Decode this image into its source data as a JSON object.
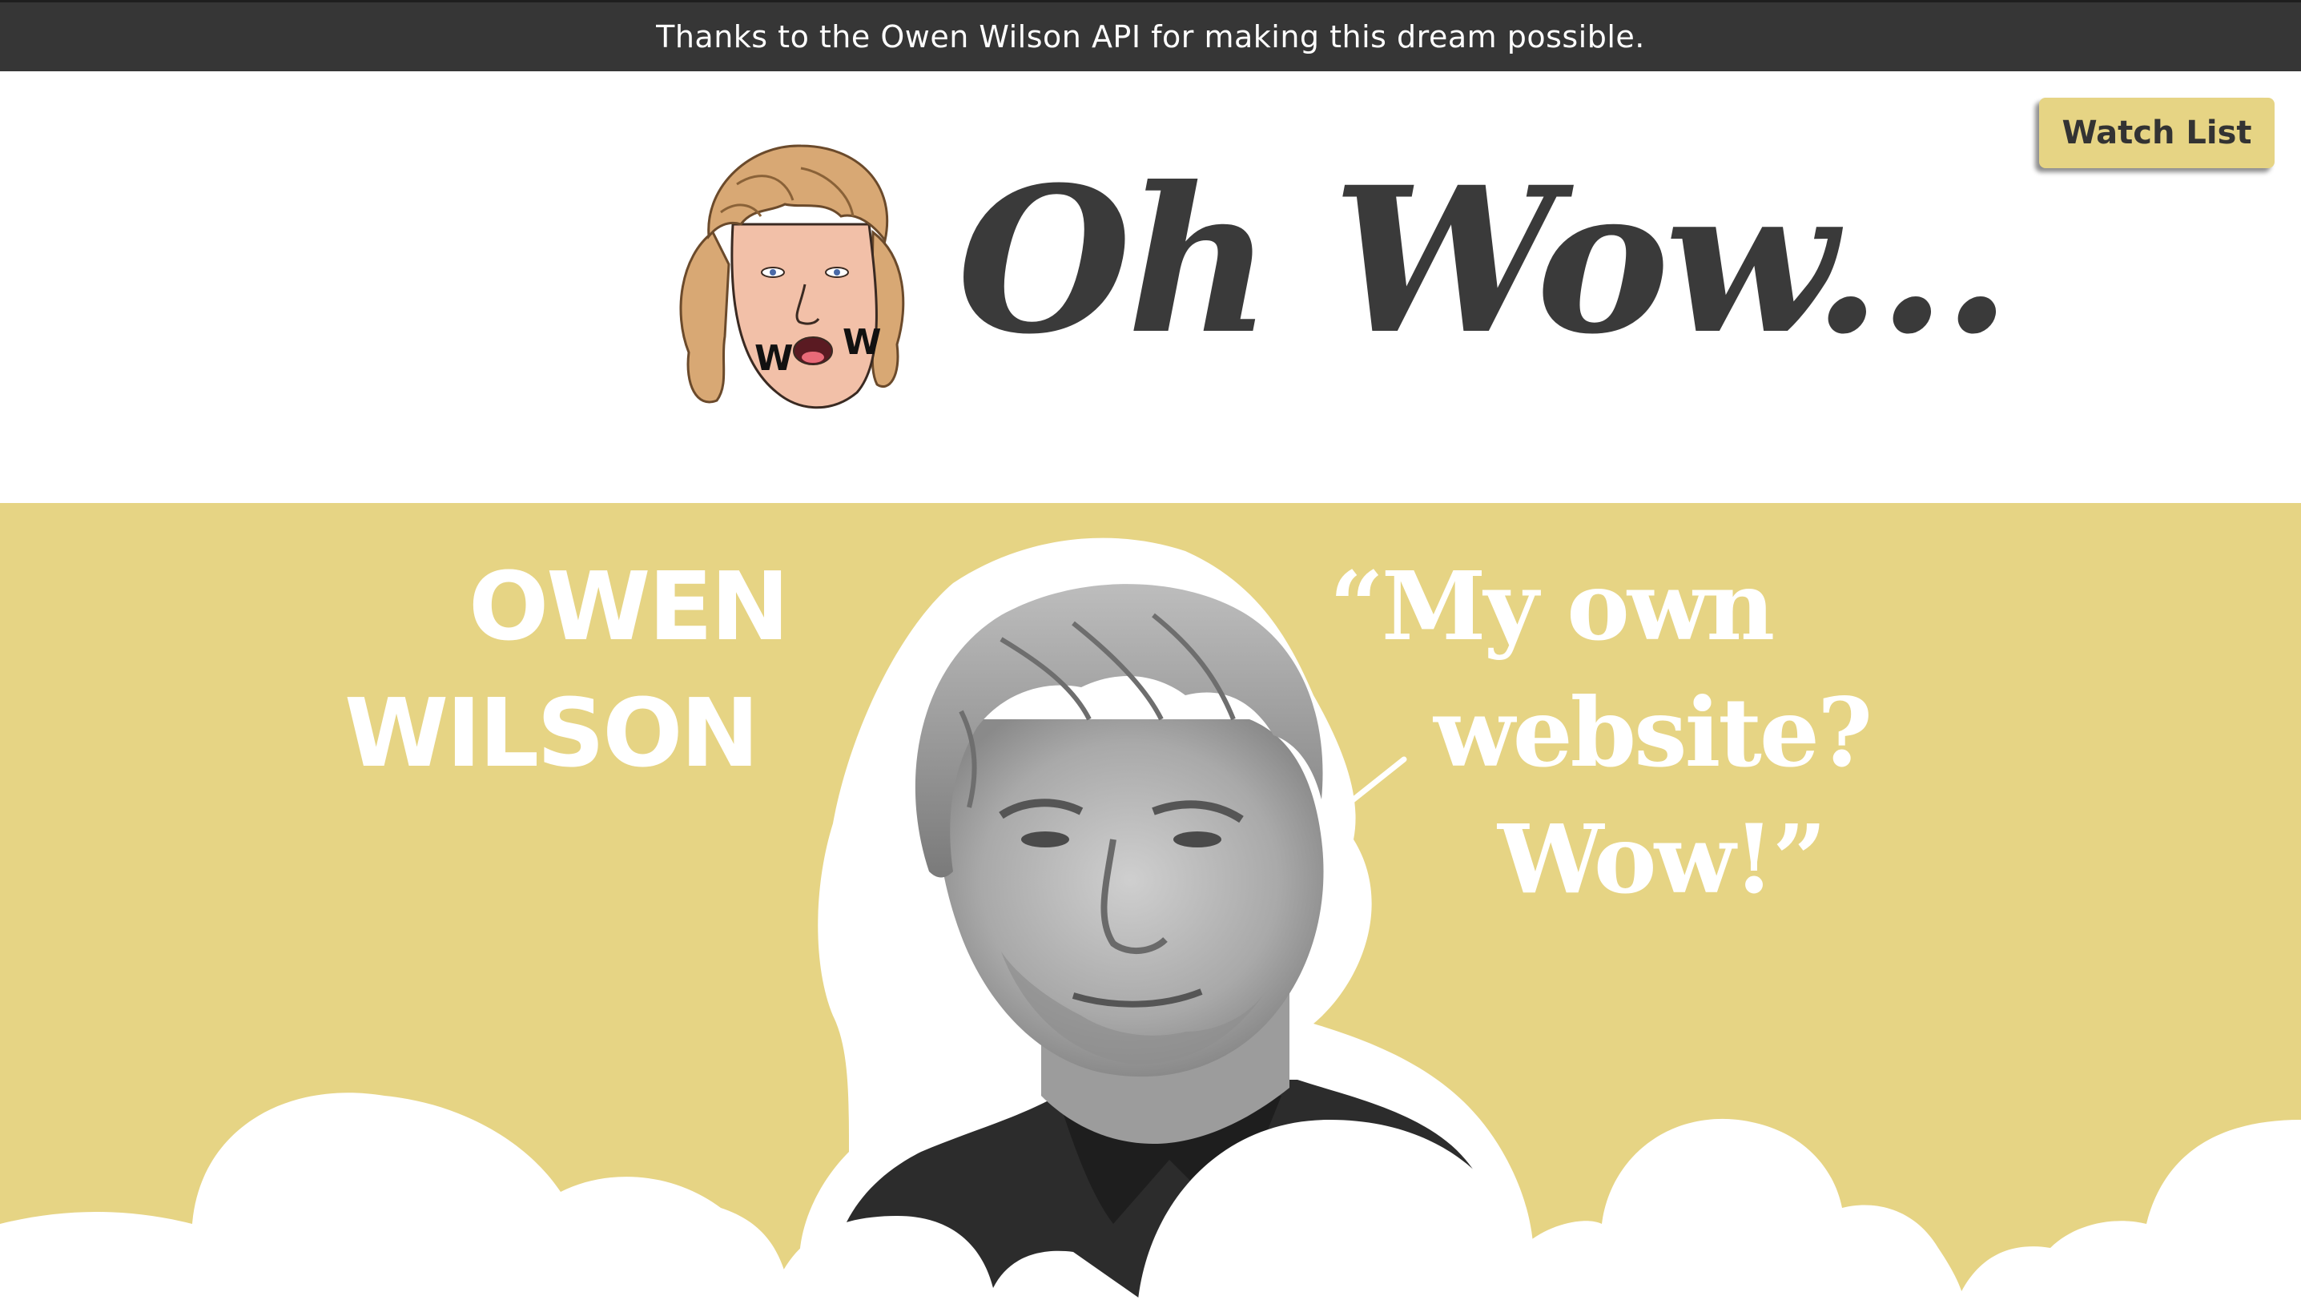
{
  "banner": {
    "text": "Thanks to the Owen Wilson API for making this dream possible."
  },
  "header": {
    "title": "Oh Wow...",
    "logo_mouth_text": "WOW",
    "watch_list_label": "Watch List"
  },
  "hero": {
    "name_line1": "OWEN",
    "name_line2": "WILSON",
    "quote_line1": "“My own",
    "quote_line2": "website?",
    "quote_line3": "Wow!”"
  },
  "colors": {
    "banner_bg": "#363636",
    "accent_yellow": "#e6d484",
    "title_text": "#3a3a3a",
    "hero_text": "#ffffff"
  },
  "icons": {
    "logo": "cartoon-face-icon",
    "portrait": "portrait-photo"
  }
}
